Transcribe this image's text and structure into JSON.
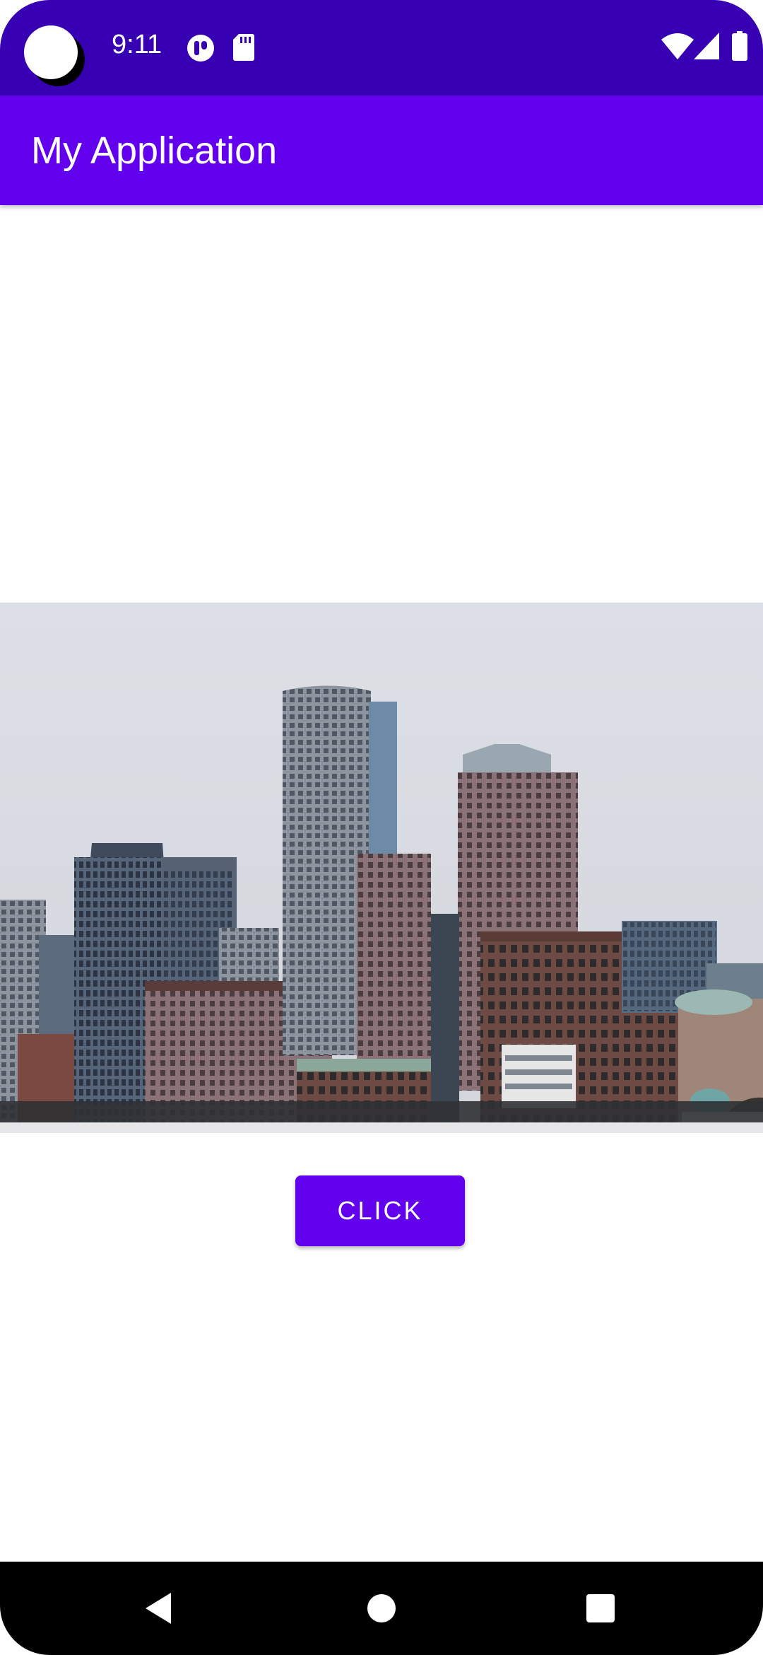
{
  "status_bar": {
    "time": "9:11",
    "icons": [
      "notification-app-icon",
      "sd-card-icon",
      "wifi-icon",
      "cell-signal-icon",
      "battery-icon"
    ]
  },
  "app_bar": {
    "title": "My Application"
  },
  "main": {
    "image": "city-skyline-photo",
    "button_label": "CLICK"
  },
  "nav_bar": {
    "buttons": [
      "back-icon",
      "home-icon",
      "recents-icon"
    ]
  },
  "colors": {
    "status_bar": "#3700b3",
    "primary": "#6200ee",
    "background": "#ffffff",
    "nav_bar": "#000000"
  }
}
